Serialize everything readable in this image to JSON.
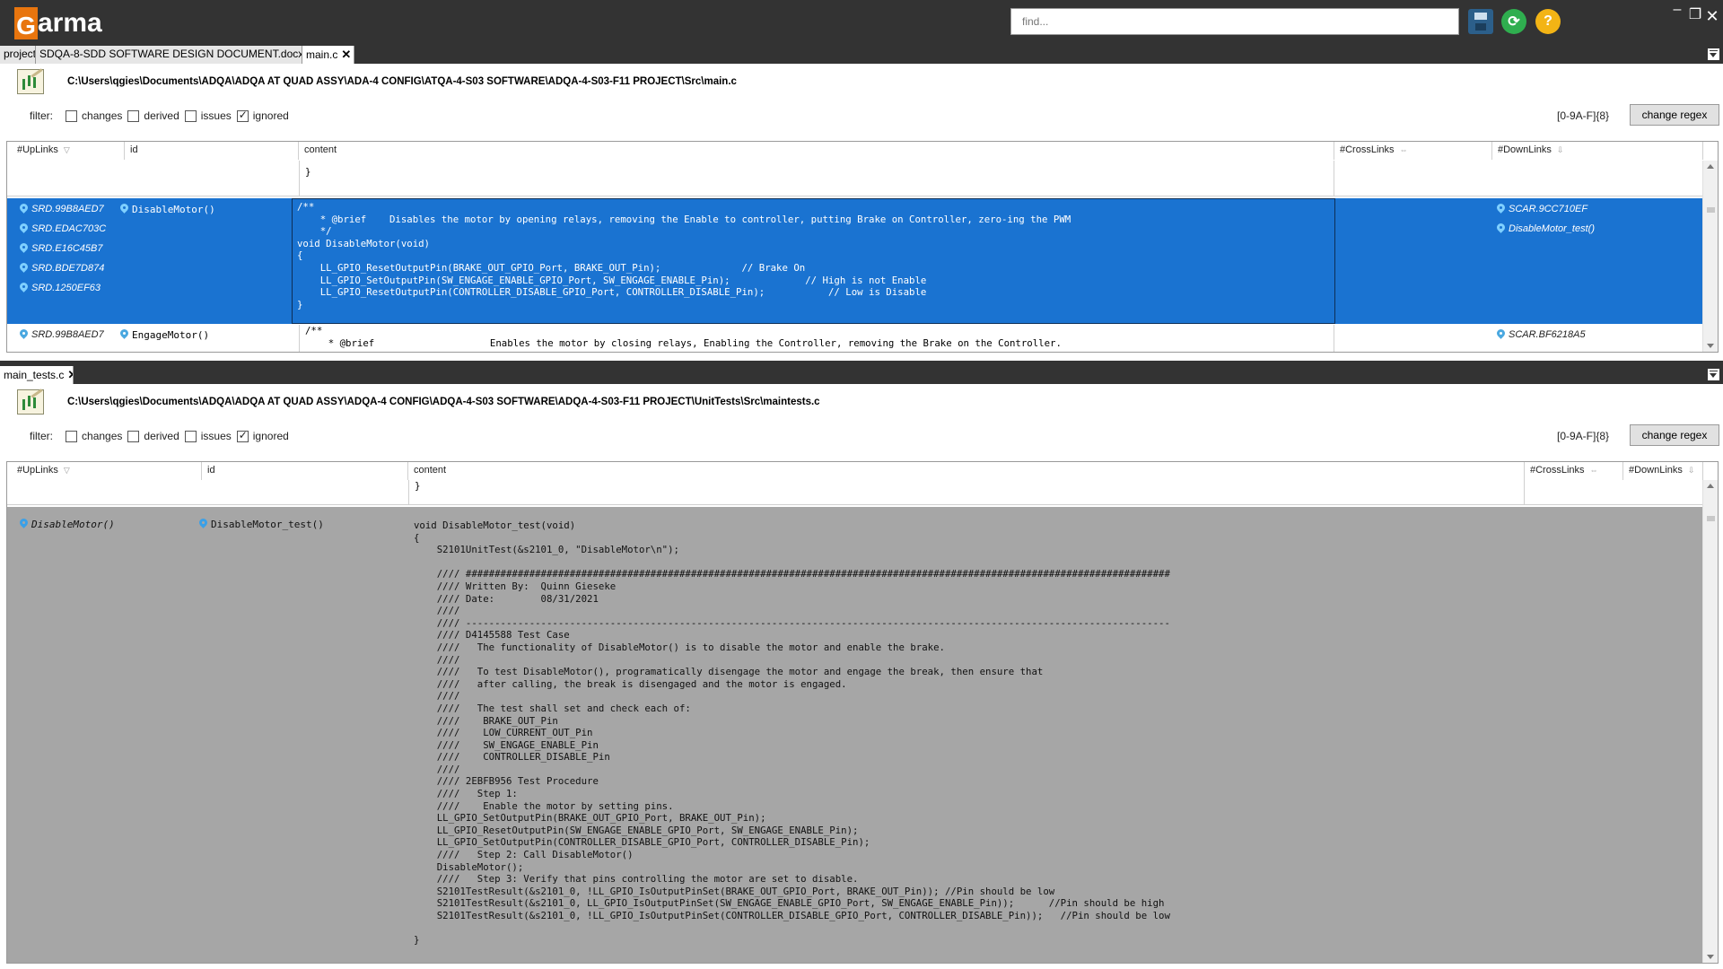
{
  "app": {
    "logo_letter": "G",
    "logo_rest": "arma"
  },
  "find": {
    "placeholder": "find..."
  },
  "window": {
    "minimize": "–",
    "maximize": "❐",
    "close": "✕"
  },
  "top_tabs": [
    {
      "label": "project"
    },
    {
      "label": "SDQA-8-SDD SOFTWARE DESIGN DOCUMENT.docx"
    },
    {
      "label": "main.c"
    }
  ],
  "bottom_tabs": [
    {
      "label": "main_tests.c"
    }
  ],
  "top_pane": {
    "path": "C:\\Users\\qgies\\Documents\\ADQA\\ADQA AT QUAD ASSY\\ADA-4 CONFIG\\ATQA-4-S03 SOFTWARE\\ADQA-4-S03-F11 PROJECT\\Src\\main.c",
    "filter_label": "filter:",
    "filters": [
      {
        "label": "changes",
        "checked": false
      },
      {
        "label": "derived",
        "checked": false
      },
      {
        "label": "issues",
        "checked": false
      },
      {
        "label": "ignored",
        "checked": true
      }
    ],
    "regex": "[0-9A-F]{8}",
    "regex_button": "change regex",
    "columns": {
      "uplinks": "#UpLinks",
      "id": "id",
      "content": "content",
      "crosslinks": "#CrossLinks",
      "downlinks": "#DownLinks"
    },
    "rows": [
      {
        "uplinks": [],
        "id": "",
        "content": "}",
        "downlinks": []
      },
      {
        "uplinks": [
          "SRD.99B8AED7",
          "SRD.EDAC703C",
          "SRD.E16C45B7",
          "SRD.BDE7D874",
          "SRD.1250EF63"
        ],
        "id": "DisableMotor()",
        "content": "/**\n    * @brief    Disables the motor by opening relays, removing the Enable to controller, putting Brake on Controller, zero-ing the PWM\n    */\nvoid DisableMotor(void)\n{\n    LL_GPIO_ResetOutputPin(BRAKE_OUT_GPIO_Port, BRAKE_OUT_Pin);              // Brake On\n    LL_GPIO_SetOutputPin(SW_ENGAGE_ENABLE_GPIO_Port, SW_ENGAGE_ENABLE_Pin);             // High is not Enable\n    LL_GPIO_ResetOutputPin(CONTROLLER_DISABLE_GPIO_Port, CONTROLLER_DISABLE_Pin);           // Low is Disable\n}",
        "downlinks": [
          "SCAR.9CC710EF",
          "DisableMotor_test()"
        ]
      },
      {
        "uplinks": [
          "SRD.99B8AED7"
        ],
        "id": "EngageMotor()",
        "content": "/**\n    * @brief                    Enables the motor by closing relays, Enabling the Controller, removing the Brake on the Controller.",
        "downlinks": [
          "SCAR.BF6218A5"
        ]
      }
    ]
  },
  "bottom_pane": {
    "path": "C:\\Users\\qgies\\Documents\\ADQA\\ADQA AT QUAD ASSY\\ADQA-4 CONFIG\\ADQA-4-S03 SOFTWARE\\ADQA-4-S03-F11 PROJECT\\UnitTests\\Src\\maintests.c",
    "filter_label": "filter:",
    "filters": [
      {
        "label": "changes",
        "checked": false
      },
      {
        "label": "derived",
        "checked": false
      },
      {
        "label": "issues",
        "checked": false
      },
      {
        "label": "ignored",
        "checked": true
      }
    ],
    "regex": "[0-9A-F]{8}",
    "regex_button": "change regex",
    "columns": {
      "uplinks": "#UpLinks",
      "id": "id",
      "content": "content",
      "crosslinks": "#CrossLinks",
      "downlinks": "#DownLinks"
    },
    "rows": [
      {
        "uplinks": [],
        "id": "",
        "content": "}",
        "downlinks": []
      },
      {
        "uplinks": [
          "DisableMotor()"
        ],
        "id": "DisableMotor_test()",
        "content": "void DisableMotor_test(void)\n{\n    S2101UnitTest(&s2101_0, \"DisableMotor\\n\");\n\n    //// ##########################################################################################################################\n    //// Written By:  Quinn Gieseke\n    //// Date:        08/31/2021\n    ////\n    //// --------------------------------------------------------------------------------------------------------------------------\n    //// D4145588 Test Case\n    ////   The functionality of DisableMotor() is to disable the motor and enable the brake.\n    ////\n    ////   To test DisableMotor(), programatically disengage the motor and engage the break, then ensure that\n    ////   after calling, the break is disengaged and the motor is engaged.\n    ////\n    ////   The test shall set and check each of:\n    ////    BRAKE_OUT_Pin\n    ////    LOW_CURRENT_OUT_Pin\n    ////    SW_ENGAGE_ENABLE_Pin\n    ////    CONTROLLER_DISABLE_Pin\n    ////\n    //// 2EBFB956 Test Procedure\n    ////   Step 1:\n    ////    Enable the motor by setting pins.\n    LL_GPIO_SetOutputPin(BRAKE_OUT_GPIO_Port, BRAKE_OUT_Pin);\n    LL_GPIO_ResetOutputPin(SW_ENGAGE_ENABLE_GPIO_Port, SW_ENGAGE_ENABLE_Pin);\n    LL_GPIO_SetOutputPin(CONTROLLER_DISABLE_GPIO_Port, CONTROLLER_DISABLE_Pin);\n    ////   Step 2: Call DisableMotor()\n    DisableMotor();\n    ////   Step 3: Verify that pins controlling the motor are set to disable.\n    S2101TestResult(&s2101_0, !LL_GPIO_IsOutputPinSet(BRAKE_OUT_GPIO_Port, BRAKE_OUT_Pin)); //Pin should be low\n    S2101TestResult(&s2101_0, LL_GPIO_IsOutputPinSet(SW_ENGAGE_ENABLE_GPIO_Port, SW_ENGAGE_ENABLE_Pin));      //Pin should be high\n    S2101TestResult(&s2101_0, !LL_GPIO_IsOutputPinSet(CONTROLLER_DISABLE_GPIO_Port, CONTROLLER_DISABLE_Pin));   //Pin should be low\n\n}",
        "downlinks": []
      }
    ]
  }
}
